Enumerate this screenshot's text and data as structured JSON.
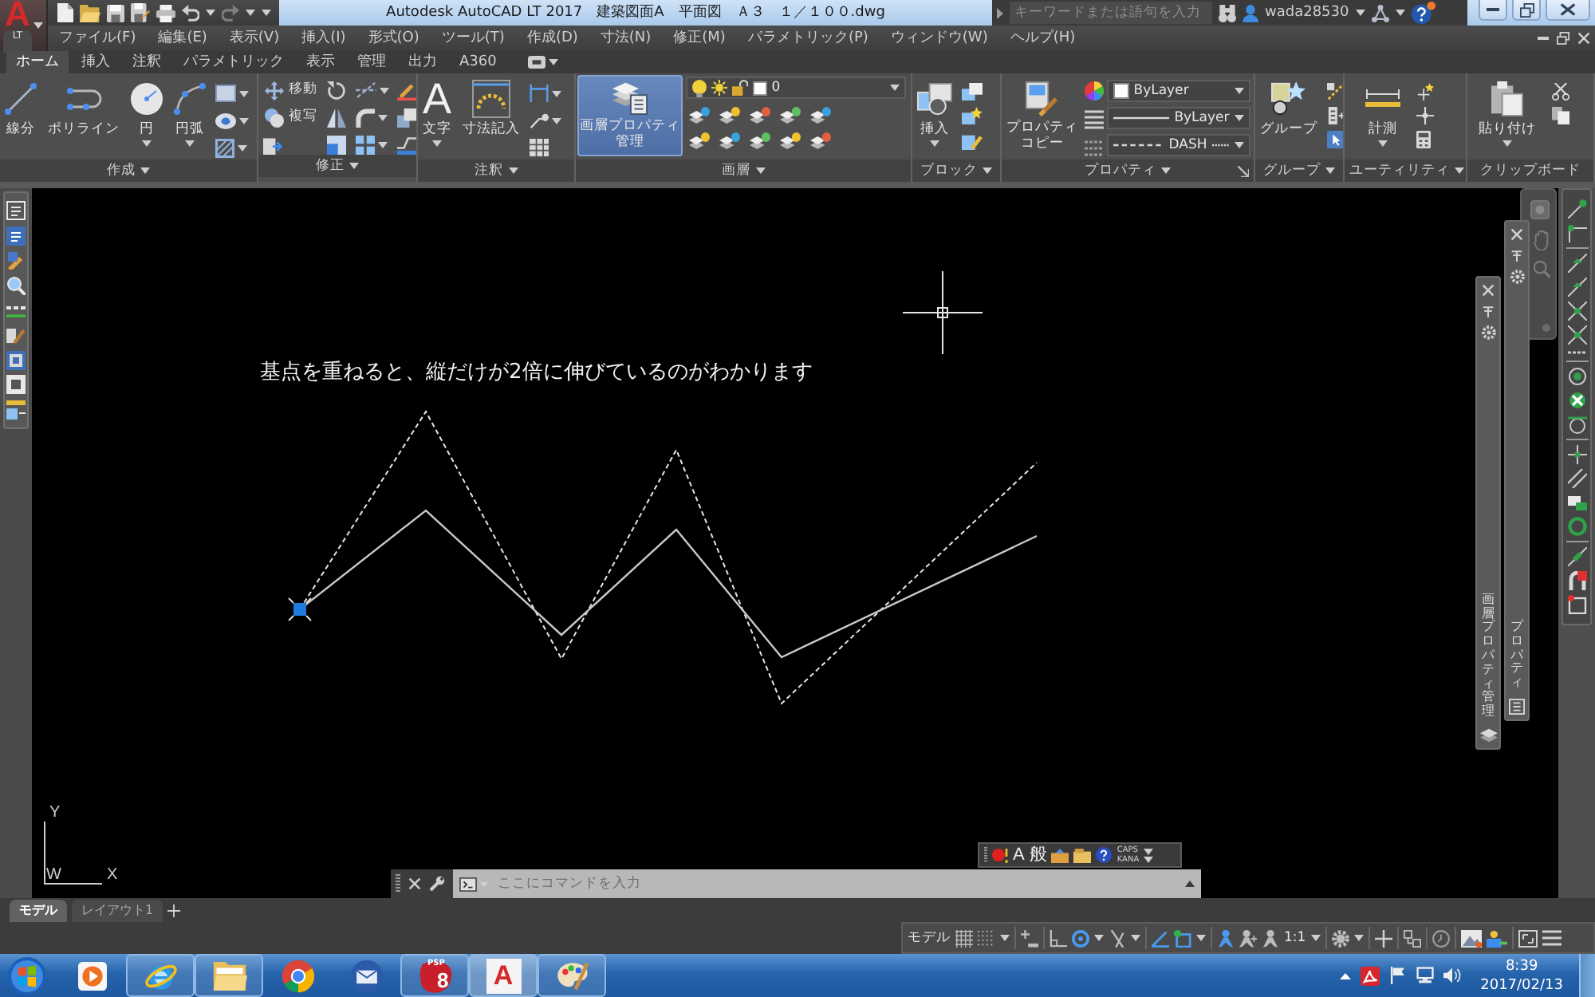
{
  "title_bar": {
    "logo": {
      "letter": "A",
      "edition": "LT"
    },
    "title": "Autodesk AutoCAD LT 2017　建築図面A　平面図　Ａ３　１／１００.dwg",
    "search": {
      "placeholder": "キーワードまたは語句を入力"
    },
    "user": "wada28530"
  },
  "menu_bar": [
    "ファイル(F)",
    "編集(E)",
    "表示(V)",
    "挿入(I)",
    "形式(O)",
    "ツール(T)",
    "作成(D)",
    "寸法(N)",
    "修正(M)",
    "パラメトリック(P)",
    "ウィンドウ(W)",
    "ヘルプ(H)"
  ],
  "ribbon": {
    "tabs": [
      {
        "label": "ホーム",
        "selected": true
      },
      {
        "label": "挿入",
        "selected": false
      },
      {
        "label": "注釈",
        "selected": false
      },
      {
        "label": "パラメトリック",
        "selected": false
      },
      {
        "label": "表示",
        "selected": false
      },
      {
        "label": "管理",
        "selected": false
      },
      {
        "label": "出力",
        "selected": false
      },
      {
        "label": "A360",
        "selected": false
      }
    ],
    "panels": [
      {
        "title": "作成",
        "expandable": true,
        "tools": [
          {
            "label": "線分",
            "highlighted": false
          },
          {
            "label": "ポリライン",
            "highlighted": false
          },
          {
            "label": "円",
            "highlighted": false
          },
          {
            "label": "円弧",
            "highlighted": false
          }
        ]
      },
      {
        "title": "修正",
        "expandable": true,
        "tools": [
          {
            "label": "移動",
            "highlighted": false
          },
          {
            "label": "複写",
            "highlighted": false
          }
        ]
      },
      {
        "title": "注釈",
        "expandable": true,
        "tools": [
          {
            "label": "文字",
            "glyph": "A",
            "highlighted": false
          },
          {
            "label": "寸法記入",
            "highlighted": false
          }
        ]
      },
      {
        "title": "画層",
        "expandable": true,
        "tools": [
          {
            "label": "画層プロパティ管理",
            "highlighted": true
          }
        ],
        "layer": "0"
      },
      {
        "title": "ブロック",
        "expandable": true,
        "tools": [
          {
            "label": "挿入",
            "highlighted": false
          }
        ]
      },
      {
        "title": "プロパティ",
        "expandable": true,
        "tools": [
          {
            "label": "プロパティコピー",
            "highlighted": false
          }
        ],
        "dropdowns": [
          {
            "kind": "swatch",
            "value": "ByLayer"
          },
          {
            "kind": "solid",
            "value": "ByLayer"
          },
          {
            "kind": "dashed",
            "value": "DASH"
          }
        ]
      },
      {
        "title": "グループ",
        "expandable": true,
        "tools": [
          {
            "label": "グループ",
            "highlighted": false
          }
        ]
      },
      {
        "title": "ユーティリティ",
        "expandable": true,
        "tools": [
          {
            "label": "計測",
            "highlighted": false
          }
        ]
      },
      {
        "title": "クリップボード",
        "expandable": false,
        "tools": [
          {
            "label": "貼り付け",
            "highlighted": false
          }
        ]
      }
    ]
  },
  "canvas": {
    "note": "基点を重ねると、縦だけが2倍に伸びているのがわかります",
    "ucs": {
      "y": "Y",
      "w": "W",
      "x": "X"
    }
  },
  "command_line": {
    "placeholder": "ここにコマンドを入力"
  },
  "ime_bar": {
    "mode": "A",
    "conversion": "般",
    "caps": "CAPS",
    "kana": "KANA"
  },
  "palettes": [
    {
      "title": "画層プロパティ管理"
    },
    {
      "title": "プロパティ"
    }
  ],
  "layout_tabs": [
    {
      "label": "モデル",
      "selected": true
    },
    {
      "label": "レイアウト1",
      "selected": false
    }
  ],
  "status_bar": {
    "space": "モデル",
    "toggles": [
      {
        "kind": "grid",
        "on": false
      },
      {
        "kind": "snap",
        "on": false
      },
      {
        "kind": "infer",
        "on": false
      },
      {
        "kind": "ortho",
        "on": false
      },
      {
        "kind": "polar",
        "on": true
      },
      {
        "kind": "isometric",
        "on": false
      },
      {
        "kind": "tracking",
        "on": true
      },
      {
        "kind": "osnap",
        "on": true
      },
      {
        "kind": "annotation",
        "on": true
      },
      {
        "kind": "autoscale",
        "on": false
      },
      {
        "kind": "scale",
        "on": false
      }
    ],
    "scale": "1:1"
  },
  "taskbar": {
    "apps": [
      {
        "kind": "media",
        "running": false,
        "selected": false
      },
      {
        "kind": "ie",
        "running": true,
        "selected": false
      },
      {
        "kind": "folder",
        "running": true,
        "selected": false
      },
      {
        "kind": "chrome",
        "running": false,
        "selected": false
      },
      {
        "kind": "mail",
        "running": false,
        "selected": false
      },
      {
        "kind": "psp",
        "badge": "PSP",
        "label": "8",
        "running": true,
        "selected": false
      },
      {
        "kind": "cad",
        "label": "A",
        "running": true,
        "selected": true
      },
      {
        "kind": "paint",
        "running": true,
        "selected": false
      }
    ],
    "time": "8:39",
    "date": "2017/02/13"
  }
}
